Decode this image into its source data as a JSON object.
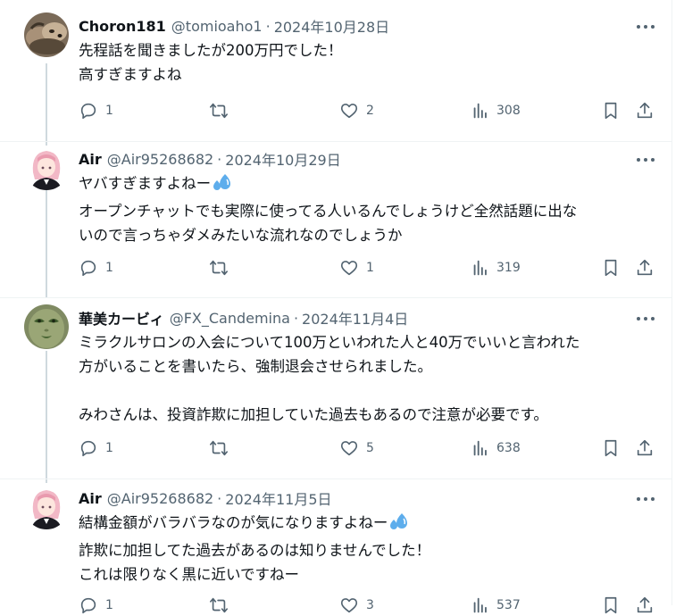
{
  "posts": [
    {
      "name": "Choron181",
      "handle": "@tomioaho1",
      "separator": "·",
      "date": "2024年10月28日",
      "lines": [
        "先程話を聞きましたが200万円でした！",
        "高すぎますよね"
      ],
      "replies": "1",
      "retweets": "",
      "likes": "2",
      "views": "308",
      "avatar_icon": "dog-photo-avatar"
    },
    {
      "name": "Air",
      "handle": "@Air95268682",
      "separator": "·",
      "date": "2024年10月29日",
      "lines": [
        "ヤバすぎますよねー",
        "オープンチャットでも実際に使ってる人いるんでしょうけど全然話題に出な",
        "いので言っちゃダメみたいな流れなのでしょうか"
      ],
      "replies": "1",
      "retweets": "",
      "likes": "1",
      "views": "319",
      "avatar_icon": "anime-girl-avatar"
    },
    {
      "name": "華美カービィ",
      "handle": "@FX_Candemina",
      "separator": "·",
      "date": "2024年11月4日",
      "lines": [
        "ミラクルサロンの入会について100万といわれた人と40万でいいと言われた",
        "方がいることを書いたら、強制退会させられました。",
        "",
        "みわさんは、投資詐欺に加担していた過去もあるので注意が必要です。"
      ],
      "replies": "1",
      "retweets": "",
      "likes": "5",
      "views": "638",
      "avatar_icon": "green-face-avatar"
    },
    {
      "name": "Air",
      "handle": "@Air95268682",
      "separator": "·",
      "date": "2024年11月5日",
      "lines": [
        "結構金額がバラバラなのが気になりますよねー",
        "詐欺に加担してた過去があるのは知りませんでした！",
        "これは限りなく黒に近いですねー"
      ],
      "replies": "1",
      "retweets": "",
      "likes": "3",
      "views": "537",
      "avatar_icon": "anime-girl-avatar"
    }
  ],
  "colors": {
    "text": "#0f1419",
    "secondary": "#536471",
    "thread_line": "#cfd9de",
    "divider": "#eff3f4",
    "sweat_emoji": "#5dadec"
  },
  "icons": [
    "more-icon",
    "reply-icon",
    "retweet-icon",
    "like-icon",
    "views-icon",
    "bookmark-icon",
    "share-icon",
    "sweat-droplets-emoji"
  ]
}
